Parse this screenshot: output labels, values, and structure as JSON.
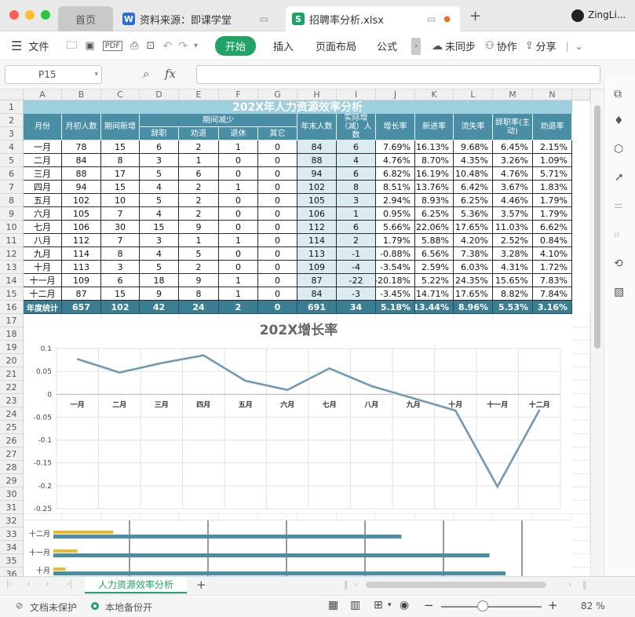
{
  "tabs": {
    "home": "首页",
    "doc": "资料来源：即课学堂",
    "active": "招聘率分析.xlsx",
    "user": "ZingLi..."
  },
  "toolbar": {
    "menu": "文件",
    "start": "开始",
    "insert": "插入",
    "layout": "页面布局",
    "formula": "公式",
    "unsync": "未同步",
    "collab": "协作",
    "share": "分享"
  },
  "formula_bar": {
    "cell_ref": "P15",
    "fx": "fx"
  },
  "columns": [
    "A",
    "B",
    "C",
    "D",
    "E",
    "F",
    "G",
    "H",
    "I",
    "J",
    "K",
    "L",
    "M",
    "N",
    ""
  ],
  "rows": [
    "1",
    "2",
    "3",
    "4",
    "5",
    "6",
    "7",
    "8",
    "9",
    "10",
    "11",
    "12",
    "13",
    "14",
    "15",
    "16",
    "17",
    "18",
    "19",
    "20",
    "21",
    "22",
    "23",
    "24",
    "25",
    "26",
    "27",
    "28",
    "29",
    "30",
    "31",
    "32",
    "33",
    "34",
    "35",
    "36"
  ],
  "table": {
    "title": "202X年人力资源效率分析",
    "headers": {
      "month": "月份",
      "start": "月初人数",
      "new": "期间新增",
      "decrease": "期间减少",
      "resign": "辞职",
      "dismiss": "劝退",
      "retire": "退休",
      "other": "其它",
      "end": "年末人数",
      "actual": "实际增（减）人数",
      "growth": "增长率",
      "entry": "新进率",
      "loss": "流失率",
      "resign_rate": "辞职率(主动)",
      "dismiss_rate": "劝退率"
    },
    "rows": [
      [
        "一月",
        "78",
        "15",
        "6",
        "2",
        "1",
        "0",
        "84",
        "6",
        "7.69%",
        "16.13%",
        "9.68%",
        "6.45%",
        "2.15%"
      ],
      [
        "二月",
        "84",
        "8",
        "3",
        "1",
        "0",
        "0",
        "88",
        "4",
        "4.76%",
        "8.70%",
        "4.35%",
        "3.26%",
        "1.09%"
      ],
      [
        "三月",
        "88",
        "17",
        "5",
        "6",
        "0",
        "0",
        "94",
        "6",
        "6.82%",
        "16.19%",
        "10.48%",
        "4.76%",
        "5.71%"
      ],
      [
        "四月",
        "94",
        "15",
        "4",
        "2",
        "1",
        "0",
        "102",
        "8",
        "8.51%",
        "13.76%",
        "6.42%",
        "3.67%",
        "1.83%"
      ],
      [
        "五月",
        "102",
        "10",
        "5",
        "2",
        "0",
        "0",
        "105",
        "3",
        "2.94%",
        "8.93%",
        "6.25%",
        "4.46%",
        "1.79%"
      ],
      [
        "六月",
        "105",
        "7",
        "4",
        "2",
        "0",
        "0",
        "106",
        "1",
        "0.95%",
        "6.25%",
        "5.36%",
        "3.57%",
        "1.79%"
      ],
      [
        "七月",
        "106",
        "30",
        "15",
        "9",
        "0",
        "0",
        "112",
        "6",
        "5.66%",
        "22.06%",
        "17.65%",
        "11.03%",
        "6.62%"
      ],
      [
        "八月",
        "112",
        "7",
        "3",
        "1",
        "1",
        "0",
        "114",
        "2",
        "1.79%",
        "5.88%",
        "4.20%",
        "2.52%",
        "0.84%"
      ],
      [
        "九月",
        "114",
        "8",
        "4",
        "5",
        "0",
        "0",
        "113",
        "-1",
        "-0.88%",
        "6.56%",
        "7.38%",
        "3.28%",
        "4.10%"
      ],
      [
        "十月",
        "113",
        "3",
        "5",
        "2",
        "0",
        "0",
        "109",
        "-4",
        "-3.54%",
        "2.59%",
        "6.03%",
        "4.31%",
        "1.72%"
      ],
      [
        "十一月",
        "109",
        "6",
        "18",
        "9",
        "1",
        "0",
        "87",
        "-22",
        "-20.18%",
        "5.22%",
        "24.35%",
        "15.65%",
        "7.83%"
      ],
      [
        "十二月",
        "87",
        "15",
        "9",
        "8",
        "1",
        "0",
        "84",
        "-3",
        "-3.45%",
        "14.71%",
        "17.65%",
        "8.82%",
        "7.84%"
      ]
    ],
    "total": [
      "年度统计",
      "657",
      "102",
      "42",
      "24",
      "2",
      "0",
      "691",
      "34",
      "5.18%",
      "13.44%",
      "8.96%",
      "5.53%",
      "3.16%"
    ]
  },
  "chart_data": [
    {
      "type": "line",
      "title": "202X增长率",
      "categories": [
        "一月",
        "二月",
        "三月",
        "四月",
        "五月",
        "六月",
        "七月",
        "八月",
        "九月",
        "十月",
        "十一月",
        "十二月"
      ],
      "values": [
        0.0769,
        0.0476,
        0.0682,
        0.0851,
        0.0294,
        0.0095,
        0.0566,
        0.0179,
        -0.0088,
        -0.0354,
        -0.2018,
        -0.0345
      ],
      "ylim": [
        -0.25,
        0.1
      ],
      "yticks": [
        "0.1",
        "0.05",
        "0",
        "-0.05",
        "-0.1",
        "-0.15",
        "-0.2",
        "-0.25"
      ],
      "color": "#6c8ea6"
    },
    {
      "type": "bar",
      "orientation": "horizontal",
      "categories": [
        "十二月",
        "十一月",
        "十月"
      ],
      "series": [
        {
          "values": [
            15,
            6,
            3
          ],
          "color": "#e8b92a"
        },
        {
          "values": [
            87,
            109,
            113
          ],
          "color": "#4a8ea6"
        }
      ]
    }
  ],
  "sheet_tab": "人力资源效率分析",
  "status": {
    "protect": "文档未保护",
    "backup": "本地备份开",
    "zoom": "82 %"
  },
  "colors": {
    "header_blue": "#4a8ea6",
    "title_blue": "#9dcfdf",
    "light_blue": "#daebf2",
    "accent_green": "#21a366"
  }
}
